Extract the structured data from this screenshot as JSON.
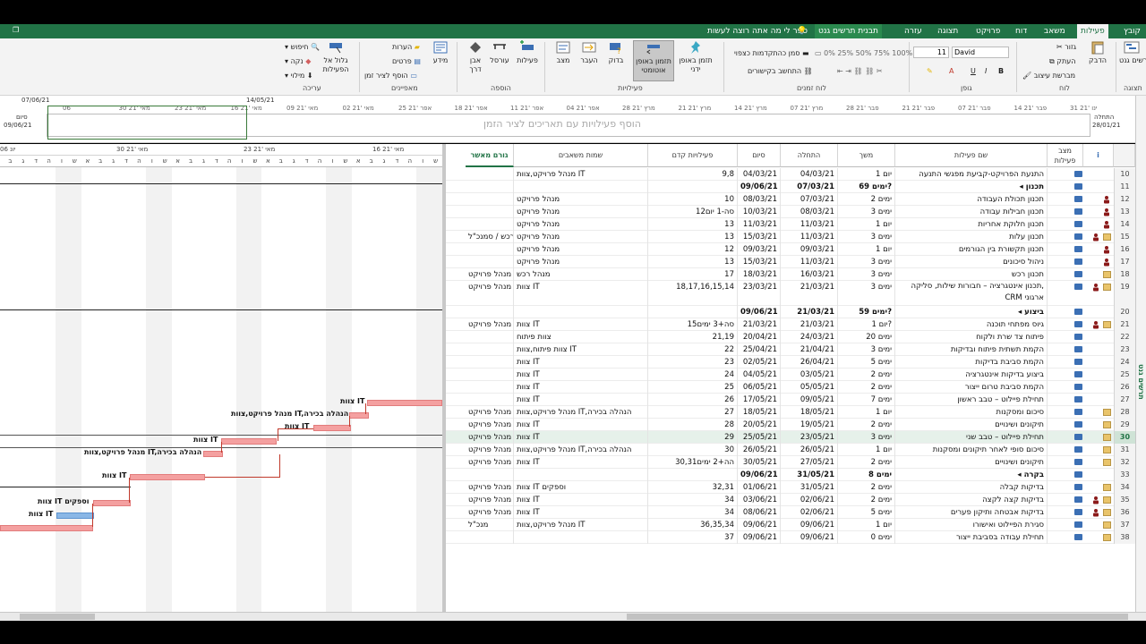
{
  "tabs": {
    "file": "קובץ",
    "task": "פעילות",
    "resource": "משאב",
    "report": "דוח",
    "project": "פרויקט",
    "view": "תצוגה",
    "help": "עזרה",
    "gantt_format": "תבנית תרשים גנט",
    "tell_me": "ספר לי מה אתה רוצה לעשות"
  },
  "ribbon": {
    "view_group": "תצוגה",
    "gantt_chart": "תרשים גנט",
    "clipboard_group": "לוח",
    "paste": "הדבק",
    "cut": "גזור",
    "copy": "העתק",
    "format_painter": "מברשת עיצוב",
    "font_group": "גופן",
    "font_name": "David",
    "font_size": "11",
    "schedule_group": "לוח זמנים",
    "mark_on_track": "סמן כהתקדמות כצפוי",
    "respect_links": "התחשב בקישורים",
    "tasks_group": "פעילויות",
    "manual_schedule": "תזמן באופן ידני",
    "auto_schedule": "תזמון באופן אוטומטי",
    "inspect": "בדוק",
    "move": "העבר",
    "mode": "מצב",
    "insert_group": "הוספה",
    "task": "פעילות",
    "summary": "עורסל",
    "milestone": "אבן דרך",
    "deliverable": "מידע",
    "properties_group": "מאפיינים",
    "notes": "הערות",
    "details": "פרטים",
    "add_to_timeline": "הוסף לציר זמן",
    "editing_group": "עריכה",
    "scroll_to_task": "גלול אל הפעילות",
    "find": "חיפוש",
    "clear": "נקה",
    "fill": "מילוי"
  },
  "timeline": {
    "hint": "הוסף פעילויות עם תאריכים לציר הזמן",
    "start_label": "התחלה",
    "start_date": "28/01/21",
    "finish_label": "סיום",
    "finish_date": "09/06/21",
    "marker_left": "07/06/21",
    "marker_right": "14/05/21",
    "ticks": [
      "31 ינו '21",
      "14 פבר '21",
      "07 פבר '21",
      "21 פבר '21",
      "28 פבר '21",
      "07 מרץ '21",
      "14 מרץ '21",
      "21 מרץ '21",
      "28 מרץ '21",
      "04 אפר '21",
      "11 אפר '21",
      "18 אפר '21",
      "25 אפר '21",
      "02 מאי '21",
      "09 מאי '21",
      "16 מאי '21",
      "23 מאי '21",
      "30 מאי '21",
      "06"
    ]
  },
  "gantt_header": {
    "weeks": [
      "16 מאי '21",
      "23 מאי '21",
      "30 מאי '21",
      "06 יונ"
    ],
    "days": [
      "ש",
      "ו",
      "ה",
      "ד",
      "ג",
      "ב",
      "א",
      "ש",
      "ו",
      "ה",
      "ד",
      "ג",
      "ב",
      "א",
      "ש",
      "ו",
      "ה",
      "ד",
      "ג",
      "ב",
      "א",
      "ש",
      "ו",
      "ה",
      "ד",
      "ג",
      "ב",
      "א",
      "ש",
      "ו",
      "ה",
      "ד",
      "ג",
      "ב",
      "א"
    ]
  },
  "gantt_labels": [
    "צוות IT",
    "מנהל פרויקט,צוות IT,הנהלה בכירה",
    "צוות IT",
    "צוות IT",
    "מנהל פרויקט,צוות IT,הנהלה בכירה",
    "צוות IT",
    "צוות IT וספקים",
    "צוות IT"
  ],
  "columns": {
    "info": "i",
    "mode": "מצב פעילות",
    "name": "שם פעילות",
    "duration": "משך",
    "start": "התחלה",
    "finish": "סיום",
    "predecessors": "פעילויות קדם",
    "resources": "שמות משאבים",
    "approver": "גורם מאשר"
  },
  "sidebar_label": "תרשים גנט",
  "rows": [
    {
      "id": "10",
      "name": "התנעת הפרויקט-קביעת מפגשי התנעה",
      "duration": "1 יום",
      "start": "04/03/21",
      "finish": "04/03/21",
      "pred": "9,8",
      "res": "מנהל פרויקט,צוות IT",
      "approver": "",
      "bold": false,
      "icon": ""
    },
    {
      "id": "11",
      "name": "◂ תכנון",
      "duration": "69 ימים?",
      "start": "07/03/21",
      "finish": "09/06/21",
      "pred": "",
      "res": "",
      "approver": "",
      "bold": true,
      "icon": ""
    },
    {
      "id": "12",
      "name": "תכנון תכולת העבודה",
      "duration": "2 ימים",
      "start": "07/03/21",
      "finish": "08/03/21",
      "pred": "10",
      "res": "מנהל פרויקט",
      "approver": "",
      "bold": false,
      "icon": "person"
    },
    {
      "id": "13",
      "name": "תכנון חבילות עבודה",
      "duration": "3 ימים",
      "start": "08/03/21",
      "finish": "10/03/21",
      "pred": "12סה-1 יום",
      "res": "מנהל פרויקט",
      "approver": "",
      "bold": false,
      "icon": "person"
    },
    {
      "id": "14",
      "name": "תכנון חלוקת אחריות",
      "duration": "1 יום",
      "start": "11/03/21",
      "finish": "11/03/21",
      "pred": "13",
      "res": "מנהל פרויקט",
      "approver": "",
      "bold": false,
      "icon": "person"
    },
    {
      "id": "15",
      "name": "תכנון עלות",
      "duration": "3 ימים",
      "start": "11/03/21",
      "finish": "15/03/21",
      "pred": "13",
      "res": "מנהל פרויקט",
      "approver": "מנהל רכש / סמנכ\"ל",
      "bold": false,
      "icon": "person2"
    },
    {
      "id": "16",
      "name": "תכנון תקשורת בין הגורמים",
      "duration": "1 יום",
      "start": "09/03/21",
      "finish": "09/03/21",
      "pred": "12",
      "res": "מנהל פרויקט",
      "approver": "",
      "bold": false,
      "icon": "person"
    },
    {
      "id": "17",
      "name": "ניהול סיכונים",
      "duration": "3 ימים",
      "start": "11/03/21",
      "finish": "15/03/21",
      "pred": "13",
      "res": "מנהל פרויקט",
      "approver": "",
      "bold": false,
      "icon": "person"
    },
    {
      "id": "18",
      "name": "תכנון רכש",
      "duration": "3 ימים",
      "start": "16/03/21",
      "finish": "18/03/21",
      "pred": "17",
      "res": "מנהל רכש",
      "approver": "מנהל פרויקט",
      "bold": false,
      "icon": "note"
    },
    {
      "id": "19",
      "name": "תכנון אינטגרציה – חבורות שילות, סליקה, CRM ארגוני",
      "duration": "3 ימים",
      "start": "21/03/21",
      "finish": "23/03/21",
      "pred": "18,17,16,15,14",
      "res": "צוות IT",
      "approver": "מנהל פרויקט",
      "bold": false,
      "icon": "person2"
    },
    {
      "id": "20",
      "name": "◂ ביצוע",
      "duration": "59 ימים?",
      "start": "21/03/21",
      "finish": "09/06/21",
      "pred": "",
      "res": "",
      "approver": "",
      "bold": true,
      "icon": ""
    },
    {
      "id": "21",
      "name": "גיוס מפתחי תוכנה",
      "duration": "1 יום?",
      "start": "21/03/21",
      "finish": "21/03/21",
      "pred": "15סה+3 ימים",
      "res": "צוות IT",
      "approver": "מנהל פרויקט",
      "bold": false,
      "icon": "person2"
    },
    {
      "id": "22",
      "name": "פיתוח צד שרת ולקוח",
      "duration": "20 ימים",
      "start": "24/03/21",
      "finish": "20/04/21",
      "pred": "21,19",
      "res": "צוות פיתוח",
      "approver": "",
      "bold": false,
      "icon": ""
    },
    {
      "id": "23",
      "name": "הקמת תשתית פיתוח ובדיקות",
      "duration": "3 ימים",
      "start": "21/04/21",
      "finish": "25/04/21",
      "pred": "22",
      "res": "צוות פיתוח,צוות IT",
      "approver": "",
      "bold": false,
      "icon": ""
    },
    {
      "id": "24",
      "name": "הקמת סביבת בדיקות",
      "duration": "5 ימים",
      "start": "26/04/21",
      "finish": "02/05/21",
      "pred": "23",
      "res": "צוות IT",
      "approver": "",
      "bold": false,
      "icon": ""
    },
    {
      "id": "25",
      "name": "ביצוע בדיקות אינטגרציה",
      "duration": "2 ימים",
      "start": "03/05/21",
      "finish": "04/05/21",
      "pred": "24",
      "res": "צוות IT",
      "approver": "",
      "bold": false,
      "icon": ""
    },
    {
      "id": "26",
      "name": "הקמת סביבת טרום ייצור",
      "duration": "2 ימים",
      "start": "05/05/21",
      "finish": "06/05/21",
      "pred": "25",
      "res": "צוות IT",
      "approver": "",
      "bold": false,
      "icon": ""
    },
    {
      "id": "27",
      "name": "תחילת פיילוט – טבב ראשון",
      "duration": "7 ימים",
      "start": "09/05/21",
      "finish": "17/05/21",
      "pred": "26",
      "res": "צוות IT",
      "approver": "",
      "bold": false,
      "icon": ""
    },
    {
      "id": "28",
      "name": "סיכום ומסקנות",
      "duration": "1 יום",
      "start": "18/05/21",
      "finish": "18/05/21",
      "pred": "27",
      "res": "מנהל פרויקט,צוות IT,הנהלה בכירה",
      "approver": "מנהל פרויקט",
      "bold": false,
      "icon": "note"
    },
    {
      "id": "29",
      "name": "תיקונים ושינויים",
      "duration": "2 ימים",
      "start": "19/05/21",
      "finish": "20/05/21",
      "pred": "28",
      "res": "צוות IT",
      "approver": "מנהל פרויקט",
      "bold": false,
      "icon": "note"
    },
    {
      "id": "30",
      "name": "תחילת פיילוט – טבב שני",
      "duration": "3 ימים",
      "start": "23/05/21",
      "finish": "25/05/21",
      "pred": "29",
      "res": "צוות IT",
      "approver": "מנהל פרויקט",
      "bold": false,
      "icon": "note",
      "selected": true
    },
    {
      "id": "31",
      "name": "סיכום סופי לאחר תיקונים ומסקנות",
      "duration": "1 יום",
      "start": "26/05/21",
      "finish": "26/05/21",
      "pred": "30",
      "res": "מנהל פרויקט,צוות IT,הנהלה בכירה",
      "approver": "מנהל פרויקט",
      "bold": false,
      "icon": "note"
    },
    {
      "id": "32",
      "name": "תיקונים ושינויים",
      "duration": "2 ימים",
      "start": "27/05/21",
      "finish": "30/05/21",
      "pred": "30,31הה+2 ימים",
      "res": "צוות IT",
      "approver": "מנהל פרויקט",
      "bold": false,
      "icon": "note"
    },
    {
      "id": "33",
      "name": "◂ בקרה",
      "duration": "8 ימים",
      "start": "31/05/21",
      "finish": "09/06/21",
      "pred": "",
      "res": "",
      "approver": "",
      "bold": true,
      "icon": ""
    },
    {
      "id": "34",
      "name": "בדיקות קבלה",
      "duration": "2 ימים",
      "start": "31/05/21",
      "finish": "01/06/21",
      "pred": "32,31",
      "res": "צוות IT וספקים",
      "approver": "מנהל פרויקט",
      "bold": false,
      "icon": "note"
    },
    {
      "id": "35",
      "name": "בדיקות קצה לקצה",
      "duration": "2 ימים",
      "start": "02/06/21",
      "finish": "03/06/21",
      "pred": "34",
      "res": "צוות IT",
      "approver": "מנהל פרויקט",
      "bold": false,
      "icon": "person2"
    },
    {
      "id": "36",
      "name": "בדיקות אבטחה ותיקון פערים",
      "duration": "5 ימים",
      "start": "02/06/21",
      "finish": "08/06/21",
      "pred": "34",
      "res": "צוות IT",
      "approver": "מנהל פרויקט",
      "bold": false,
      "icon": "person2"
    },
    {
      "id": "37",
      "name": "סגירת הפיילוט ואישורו",
      "duration": "1 יום",
      "start": "09/06/21",
      "finish": "09/06/21",
      "pred": "36,35,34",
      "res": "מנהל פרויקט,צוות IT",
      "approver": "מנכ\"ל",
      "bold": false,
      "icon": "note"
    },
    {
      "id": "38",
      "name": "תחילת עבודה בסביבת ייצור",
      "duration": "0 ימים",
      "start": "09/06/21",
      "finish": "09/06/21",
      "pred": "37",
      "res": "",
      "approver": "",
      "bold": false,
      "icon": "note"
    }
  ],
  "colors": {
    "accent": "#217346",
    "bar": "#f4a0a0",
    "bar_blue": "#8ab7e6",
    "mode_icon": "#3b6fb4"
  }
}
